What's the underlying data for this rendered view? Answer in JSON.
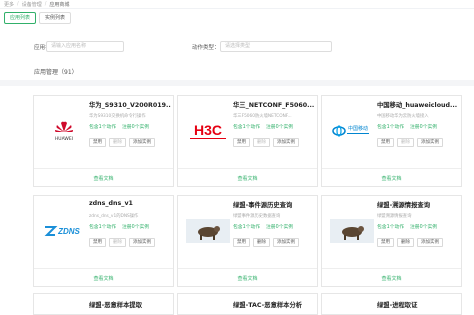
{
  "breadcrumb": [
    "更多",
    "设备管理",
    "应用商城"
  ],
  "tabs": [
    "应用列表",
    "实例列表"
  ],
  "filters": {
    "app_label": "应用名称：",
    "app_placeholder": "请输入应用名称",
    "action_label": "动作类型：",
    "action_placeholder": "请选择类型"
  },
  "section_title": "应用管理（91）",
  "cards": [
    {
      "title": "华为_S9310_V200R019...",
      "desc": "华为S9310交换机命令行操作",
      "stats": [
        "包含1个动作",
        "注册0个实例"
      ],
      "buttons": [
        "禁用",
        "删除",
        "添加实例"
      ],
      "doc": "查看文档",
      "logo": "huawei-logo",
      "logo_text": "HUAWEI"
    },
    {
      "title": "华三_NETCONF_F5060...",
      "desc": "华三F5060防火墙NETCONF...",
      "stats": [
        "包含1个动作",
        "注册0个实例"
      ],
      "buttons": [
        "禁用",
        "删除",
        "添加实例"
      ],
      "doc": "查看文档",
      "logo": "h3c-logo",
      "logo_text": "H3C"
    },
    {
      "title": "中国移动_huaweicloud...",
      "desc": "中国移动华为云防火墙接入",
      "stats": [
        "包含1个动作",
        "注册0个实例"
      ],
      "buttons": [
        "禁用",
        "删除",
        "添加实例"
      ],
      "doc": "查看文档",
      "logo": "china-mobile-logo",
      "logo_text": "中国移动"
    },
    {
      "title": "zdns_dns_v1",
      "desc": "zdns_dns_v1的DNS操作",
      "stats": [
        "包含1个动作",
        "注册0个实例"
      ],
      "buttons": [
        "禁用",
        "删除",
        "添加实例"
      ],
      "doc": "查看文档",
      "logo": "zdns-logo",
      "logo_text": "ZDNS"
    },
    {
      "title": "绿盟-事件源历史查询",
      "desc": "绿盟事件源历史数据查询",
      "stats": [
        "包含1个动作",
        "注册0个实例"
      ],
      "buttons": [
        "禁用",
        "删除",
        "添加实例"
      ],
      "doc": "查看文档",
      "logo": "nsfocus-logo",
      "logo_text": ""
    },
    {
      "title": "绿盟-溯源情报查询",
      "desc": "绿盟溯源情报查询",
      "stats": [
        "包含1个动作",
        "注册0个实例"
      ],
      "buttons": [
        "禁用",
        "删除",
        "添加实例"
      ],
      "doc": "查看文档",
      "logo": "nsfocus-logo",
      "logo_text": ""
    },
    {
      "title": "绿盟-恶意样本提取",
      "desc": "",
      "stats": [],
      "buttons": [],
      "doc": "",
      "logo": "",
      "logo_text": ""
    },
    {
      "title": "绿盟-TAC-恶意样本分析",
      "desc": "",
      "stats": [],
      "buttons": [],
      "doc": "",
      "logo": "",
      "logo_text": ""
    },
    {
      "title": "绿盟-进程取证",
      "desc": "",
      "stats": [],
      "buttons": [],
      "doc": "",
      "logo": "",
      "logo_text": ""
    }
  ],
  "colors": {
    "accent": "#31b06a",
    "huawei_red": "#cf0a2c",
    "h3c_red": "#e60012",
    "cmcc_blue": "#0085d0",
    "zdns_blue": "#1a8fd8"
  }
}
